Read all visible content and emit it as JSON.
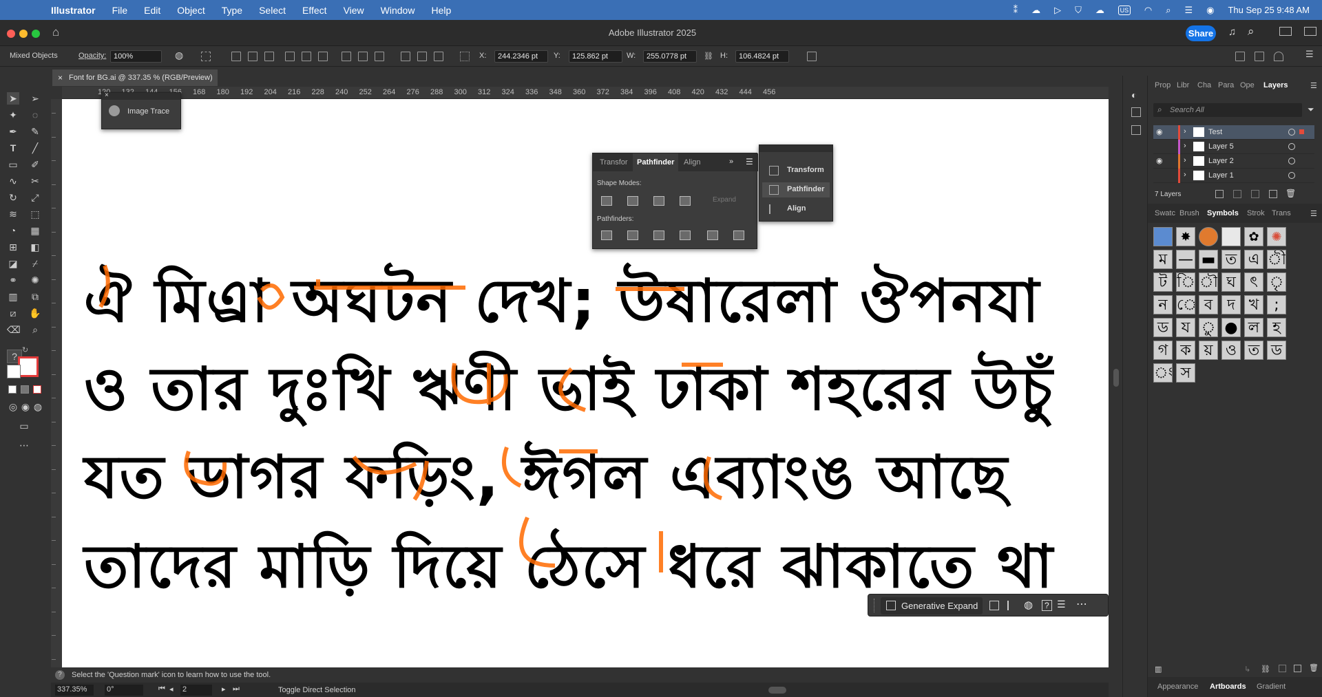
{
  "menubar": {
    "app_name": "Illustrator",
    "items": [
      "File",
      "Edit",
      "Object",
      "Type",
      "Select",
      "Effect",
      "View",
      "Window",
      "Help"
    ],
    "clock": "Thu Sep 25  9:48 AM",
    "input_source": "US"
  },
  "window": {
    "title": "Adobe Illustrator 2025",
    "share_label": "Share"
  },
  "controlbar": {
    "selection": "Mixed Objects",
    "opacity_label": "Opacity:",
    "opacity_value": "100%",
    "x_label": "X:",
    "x_value": "244.2346 pt",
    "y_label": "Y:",
    "y_value": "125.862 pt",
    "w_label": "W:",
    "w_value": "255.0778 pt",
    "h_label": "H:",
    "h_value": "106.4824 pt"
  },
  "document": {
    "tab_title": "Font for BG.ai @ 337.35 % (RGB/Preview)",
    "ruler_marks": [
      "120",
      "132",
      "144",
      "156",
      "168",
      "180",
      "192",
      "204",
      "216",
      "228",
      "240",
      "252",
      "264",
      "276",
      "288",
      "300",
      "312",
      "324",
      "336",
      "348",
      "360",
      "372",
      "384",
      "396",
      "408",
      "420",
      "432",
      "444",
      "456"
    ],
    "text_lines": [
      "ঐ মিএ্রা অঘটন দেখ; উষারেলা ঔপনযা",
      "ও তার দুঃখি ঋণী ভাই ঢাকা শহরের উচুঁ",
      "যত ডাগর ফড়িং, ঈগল এব্যাংঙ আছে",
      "তাদের মাড়ি দিয়ে ঠেসে ধরে ঝাকাতে থা"
    ]
  },
  "image_trace_panel": {
    "label": "Image Trace"
  },
  "pathfinder_panel": {
    "tabs": [
      "Transfor",
      "Pathfinder",
      "Align"
    ],
    "shape_modes_label": "Shape Modes:",
    "expand_label": "Expand",
    "pathfinders_label": "Pathfinders:"
  },
  "mini_panel": {
    "items": [
      "Transform",
      "Pathfinder",
      "Align"
    ]
  },
  "right_panel": {
    "top_tabs": [
      "Prop",
      "Libr",
      "Cha",
      "Para",
      "Ope",
      "Layers"
    ],
    "search_placeholder": "Search All",
    "layers": [
      "Test",
      "Layer 5",
      "Layer 2",
      "Layer 1"
    ],
    "layers_count": "7 Layers",
    "mid_tabs": [
      "Swatc",
      "Brush",
      "Symbols",
      "Strok",
      "Trans"
    ],
    "symbol_glyphs": [
      "ম",
      "—",
      "▬",
      "ত",
      "এ",
      "ী",
      "ট",
      "ি",
      "ৗ",
      "ঘ",
      "ৎ",
      "ৃ",
      "ন",
      "ে",
      "ব",
      "দ",
      "খ",
      ";",
      "ড",
      "য",
      "ু",
      "●",
      "ল",
      "হ",
      "গ",
      "ক",
      "য়",
      "ও",
      "ত",
      "ড",
      "ং",
      "স"
    ],
    "bottom_tabs": [
      "Appearance",
      "Artboards",
      "Gradient"
    ]
  },
  "taskbar": {
    "generative_expand": "Generative Expand"
  },
  "status": {
    "hint": "Select the 'Question mark' icon to learn how to use the tool.",
    "zoom": "337.35%",
    "rotation": "0°",
    "artboard_number": "2",
    "toggle_label": "Toggle Direct Selection"
  },
  "colors": {
    "menubar": "#3a6fb5",
    "accent": "#1473e6",
    "anchor": "#ff6a00"
  }
}
